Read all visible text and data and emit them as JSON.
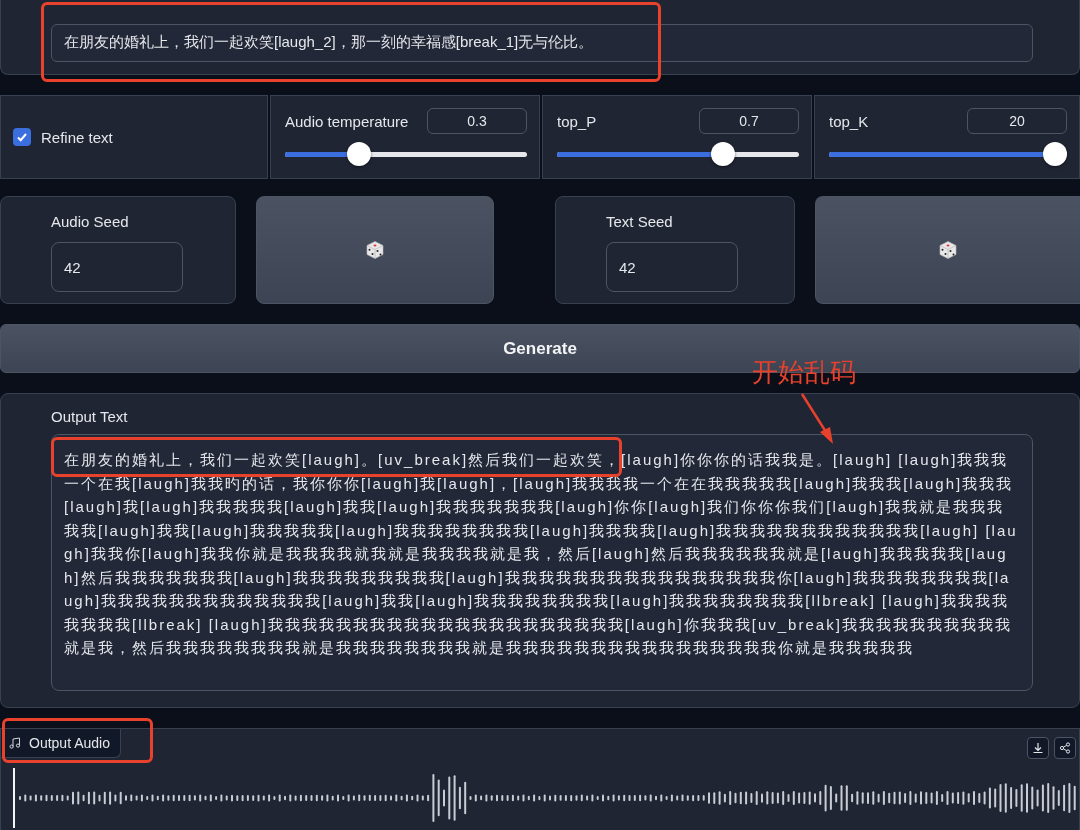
{
  "input_text": {
    "value": "在朋友的婚礼上，我们一起欢笑[laugh_2]，那一刻的幸福感[break_1]无与伦比。"
  },
  "settings": [
    {
      "kind": "checkbox",
      "label": "Refine text",
      "checked": true
    },
    {
      "kind": "slider",
      "label": "Audio temperature",
      "value": "0.3",
      "level": 0.32
    },
    {
      "kind": "slider",
      "label": "top_P",
      "value": "0.7",
      "level": 0.72
    },
    {
      "kind": "slider",
      "label": "top_K",
      "value": "20",
      "level": 1
    }
  ],
  "seeds": [
    {
      "label": "Audio Seed",
      "value": "42"
    },
    {
      "label": "Text Seed",
      "value": "42"
    }
  ],
  "generate_button": {
    "label": "Generate"
  },
  "output_text": {
    "label": "Output Text",
    "value": "在朋友的婚礼上，我们一起欢笑[laugh]。[uv_break]然后我们一起欢笑，[laugh]你你你的话我我是。[laugh] [laugh]我我我一个在我[laugh]我我旳的话，我你你你[laugh]我[laugh]，[laugh]我我我我一个在在我我我我我[laugh]我我我[laugh]我我我[laugh]我[laugh]我我我我我[laugh]我我[laugh]我我我我我我我[laugh]你你[laugh]我们你你你我们[laugh]我我就是我我我我我[laugh]我我[laugh]我我我我我[laugh]我我我我我我我我[laugh]我我我我[laugh]我我我我我我我我我我我我[laugh] [laugh]我我你[laugh]我我你就是我我我我就我就是我我我我就是我，然后[laugh]然后我我我我我我就是[laugh]我我我我我[laugh]然后我我我我我我我[laugh]我我我我我我我我我[laugh]我我我我我我我我我我我我我我我我你[laugh]我我我我我我我我[laugh]我我我我我我我我我我我我我[laugh]我我[laugh]我我我我我我我我[laugh]我我我我我我我我[llbreak] [laugh]我我我我我我我我[llbreak] [laugh]我我我我我我我我我我我我我我我我我我我我我[laugh]你我我我[uv_break]我我我我我我我我我我就是我，然后我我我我我我我我就是我我我我我我我我就是我我我我我我我我我我我我我我我我你就是我我我我我"
  },
  "output_audio": {
    "label": "Output Audio"
  },
  "annotation": {
    "text": "开始乱码"
  }
}
